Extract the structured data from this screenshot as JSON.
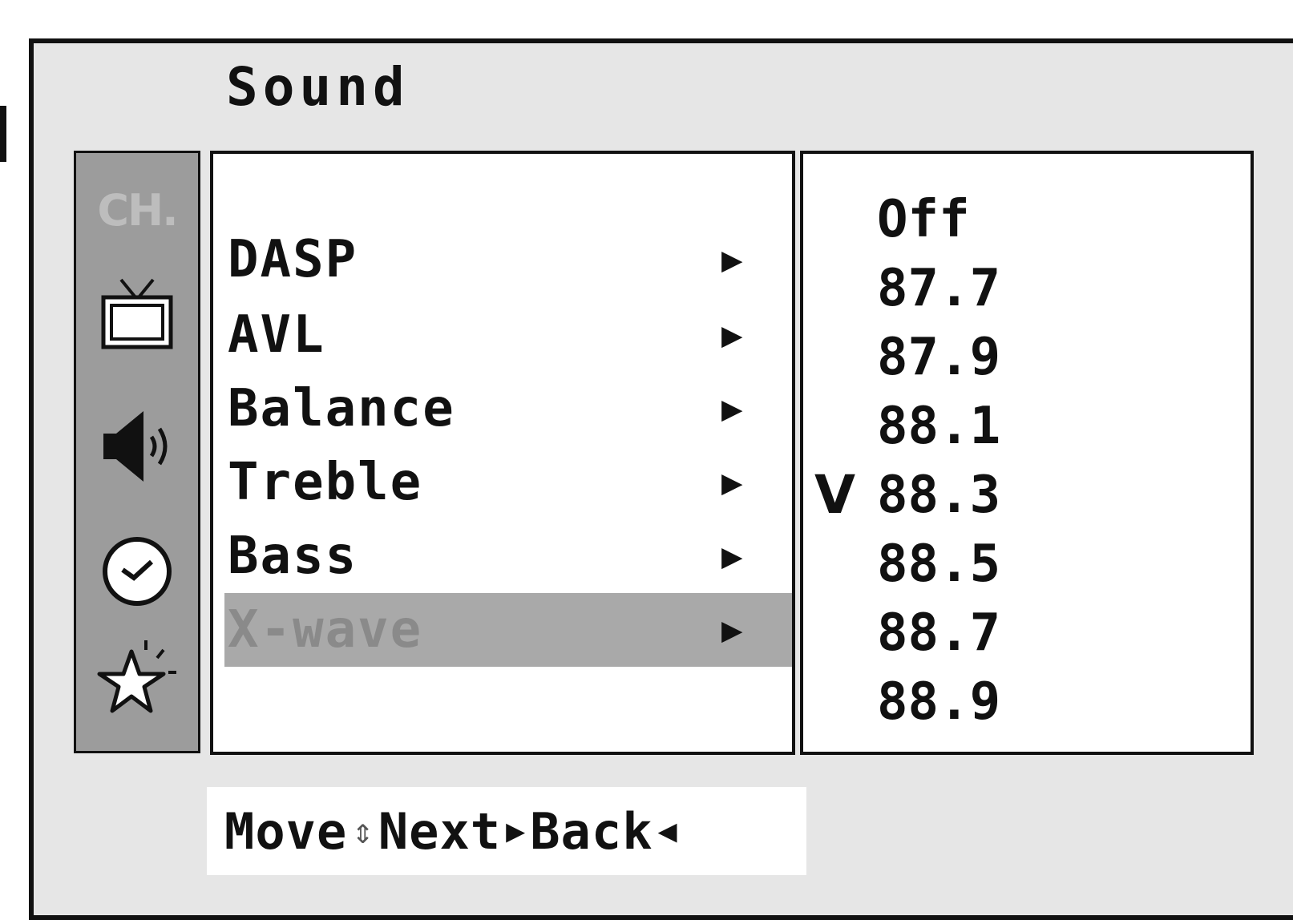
{
  "menu": {
    "title": "Sound",
    "side_icons": [
      {
        "name": "ch-icon",
        "text": "CH."
      },
      {
        "name": "tv-icon"
      },
      {
        "name": "speaker-icon"
      },
      {
        "name": "clock-icon"
      },
      {
        "name": "star-icon"
      }
    ],
    "items": [
      {
        "label": "DASP",
        "arrow": "▶"
      },
      {
        "label": "AVL",
        "arrow": "▶"
      },
      {
        "label": "Balance",
        "arrow": "▶"
      },
      {
        "label": "Treble",
        "arrow": "▶"
      },
      {
        "label": "Bass",
        "arrow": "▶"
      },
      {
        "label": "X-wave",
        "arrow": "▶",
        "selected": true
      }
    ],
    "values": [
      {
        "value": "Off",
        "check": ""
      },
      {
        "value": "87.7",
        "check": ""
      },
      {
        "value": "87.9",
        "check": ""
      },
      {
        "value": "88.1",
        "check": ""
      },
      {
        "value": "88.3",
        "check": "V"
      },
      {
        "value": "88.5",
        "check": ""
      },
      {
        "value": "88.7",
        "check": ""
      },
      {
        "value": "88.9",
        "check": ""
      }
    ]
  },
  "help": {
    "move": "Move",
    "move_glyph": "⇕",
    "next": "Next",
    "next_glyph": "▶",
    "back": "Back",
    "back_glyph": "◀"
  }
}
